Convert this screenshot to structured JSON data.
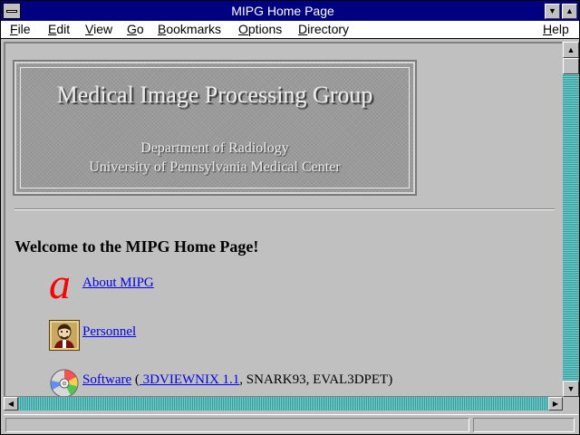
{
  "window": {
    "title": "MIPG Home Page"
  },
  "menubar": {
    "items": [
      {
        "label": "File",
        "underline": "F",
        "rest": "ile"
      },
      {
        "label": "Edit",
        "underline": "E",
        "rest": "dit"
      },
      {
        "label": "View",
        "underline": "V",
        "rest": "iew"
      },
      {
        "label": "Go",
        "underline": "G",
        "rest": "o"
      },
      {
        "label": "Bookmarks",
        "underline": "B",
        "rest": "ookmarks"
      },
      {
        "label": "Options",
        "underline": "O",
        "rest": "ptions"
      },
      {
        "label": "Directory",
        "underline": "D",
        "rest": "irectory"
      },
      {
        "label": "Help",
        "underline": "H",
        "rest": "elp"
      }
    ]
  },
  "banner": {
    "title": "Medical Image Processing Group",
    "department": "Department of Radiology",
    "university": "University of Pennsylvania Medical Center"
  },
  "page": {
    "welcome": "Welcome to the MIPG Home Page!",
    "about_icon_glyph": "a",
    "about_link": "About MIPG",
    "personnel_link": "Personnel",
    "software_link": "Software",
    "software_open_paren": " (",
    "software_sublink": " 3DVIEWNIX 1.1",
    "software_rest": ", SNARK93, EVAL3DPET)"
  },
  "colors": {
    "titlebar": "#000080",
    "link": "#0000ee",
    "scroll_track": "#6ecece"
  },
  "icons": {
    "system_menu": "system-menu-icon",
    "minimize": "minimize-icon",
    "maximize": "maximize-icon",
    "scroll_up": "arrow-up-icon",
    "scroll_down": "arrow-down-icon",
    "scroll_left": "arrow-left-icon",
    "scroll_right": "arrow-right-icon",
    "about": "letter-a-icon",
    "personnel": "portrait-icon",
    "software": "compact-disc-icon"
  }
}
